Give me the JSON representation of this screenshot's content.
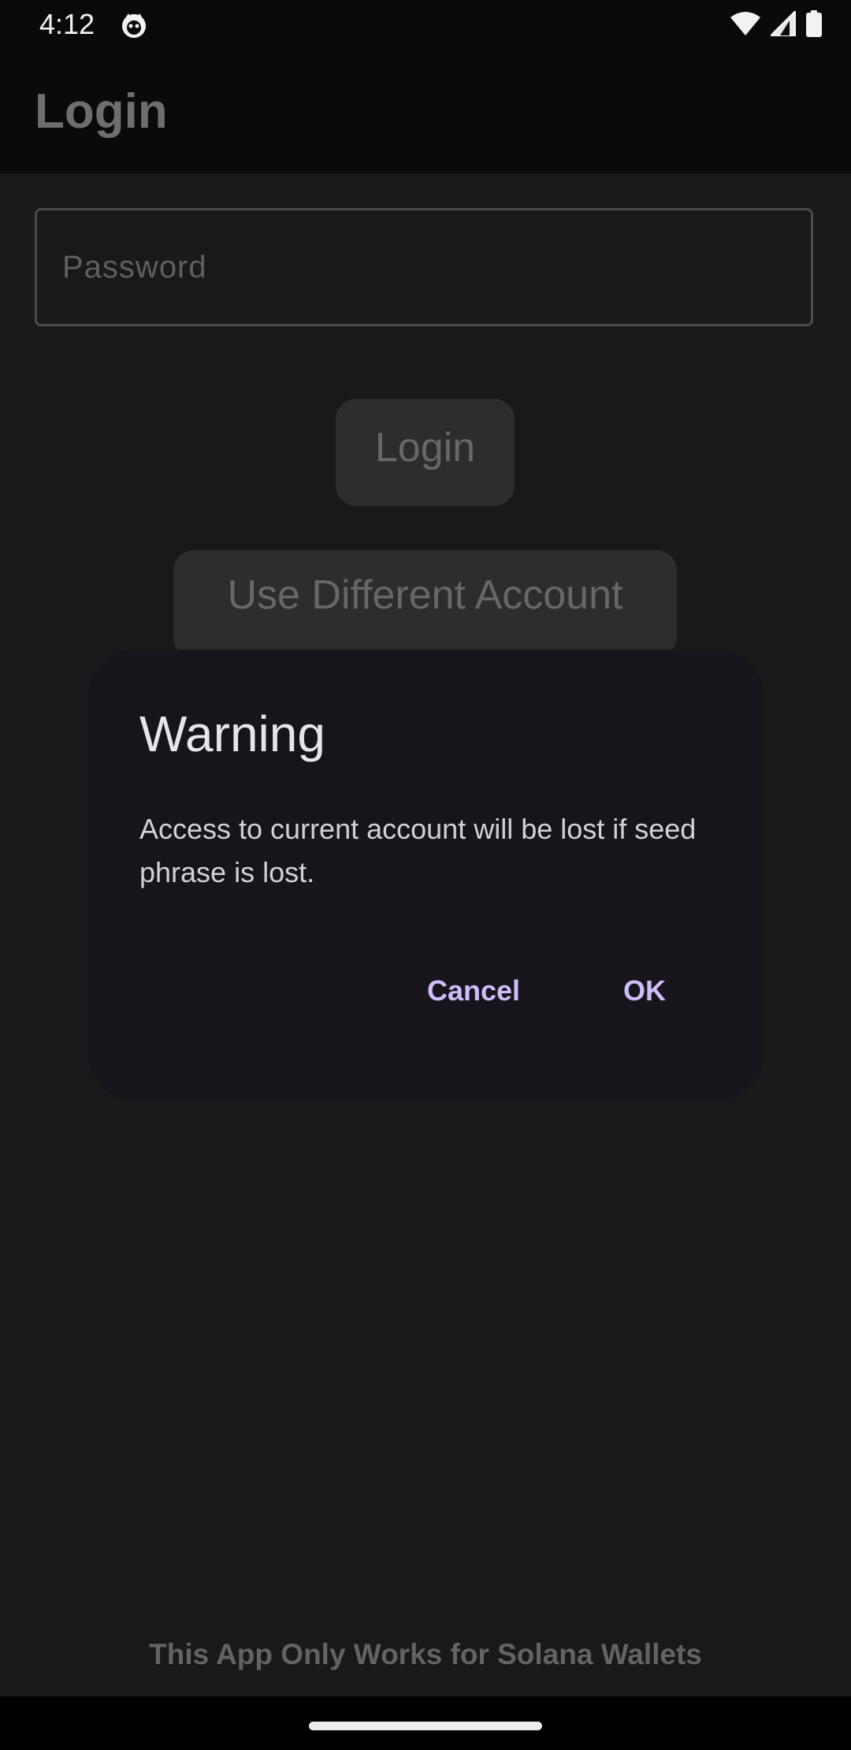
{
  "status_bar": {
    "time": "4:12",
    "icons": [
      "cat-app-icon",
      "wifi-icon",
      "cellular-signal-icon",
      "battery-icon"
    ]
  },
  "app_bar": {
    "title": "Login"
  },
  "form": {
    "password_placeholder": "Password",
    "password_value": "",
    "login_label": "Login",
    "different_account_label": "Use Different Account"
  },
  "dialog": {
    "title": "Warning",
    "message": "Access to current account will be lost if seed phrase is lost.",
    "cancel_label": "Cancel",
    "ok_label": "OK"
  },
  "footer": {
    "note": "This App Only Works for Solana Wallets"
  },
  "colors": {
    "background": "#191919",
    "bars": "#0a0a0c",
    "dialog_surface": "#17151c",
    "dialog_action": "#d0bcfa",
    "dimmed_text": "#676767"
  }
}
